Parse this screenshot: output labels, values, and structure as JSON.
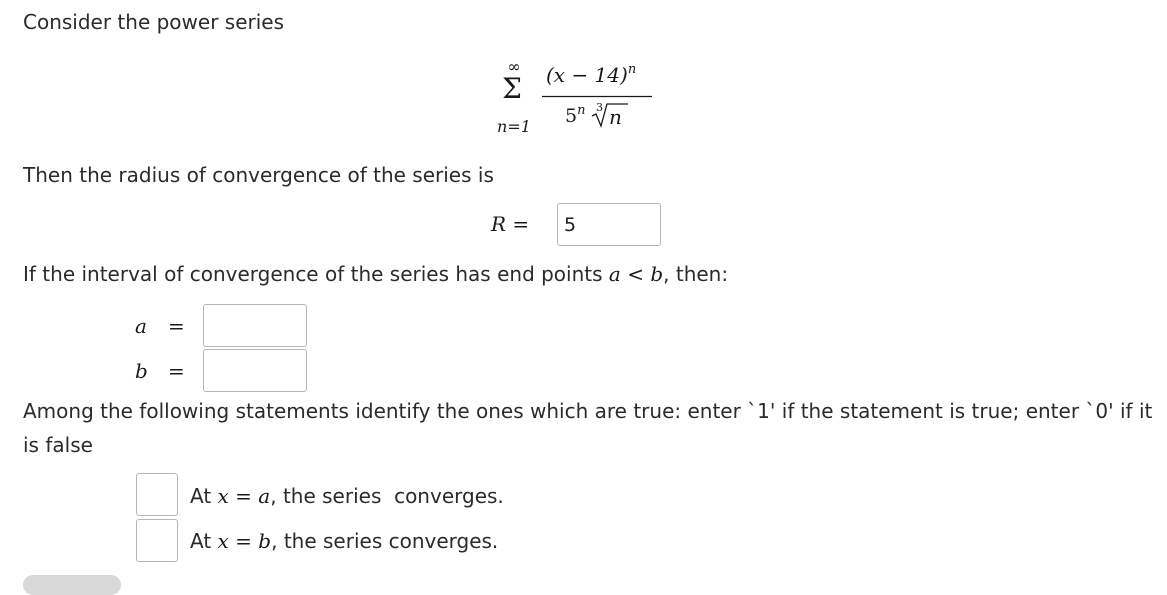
{
  "question": {
    "intro": "Consider the power series",
    "series": {
      "sum_upper": "∞",
      "sum_symbol": "Σ",
      "sum_lower": "n=1",
      "numerator_base": "(x − 14)",
      "numerator_exp": "n",
      "denominator_base": "5",
      "denominator_exp": "n",
      "root_index": "3",
      "root_radicand": "n"
    },
    "radius_prompt": "Then the radius of convergence of the series is",
    "radius_label": "R",
    "radius_eq": "=",
    "radius_value": "5",
    "interval_prompt_pre": "If the interval of convergence of the series has end points",
    "interval_a": "a",
    "interval_lt": "<",
    "interval_b": "b",
    "interval_prompt_post": ", then:",
    "a_label": "a",
    "a_eq": "=",
    "a_value": "",
    "b_label": "b",
    "b_eq": "=",
    "b_value": "",
    "statements_prompt_line1": "Among the following statements identify the ones which are true: enter `1' if the statement is true; enter `0' if it",
    "statements_prompt_line2": "is false",
    "statements": [
      {
        "value": "",
        "pre": "At",
        "var": "x",
        "eq": "=",
        "end": "a",
        "post": ", the series  converges."
      },
      {
        "value": "",
        "pre": "At",
        "var": "x",
        "eq": "=",
        "end": "b",
        "post": ", the series converges."
      }
    ]
  }
}
